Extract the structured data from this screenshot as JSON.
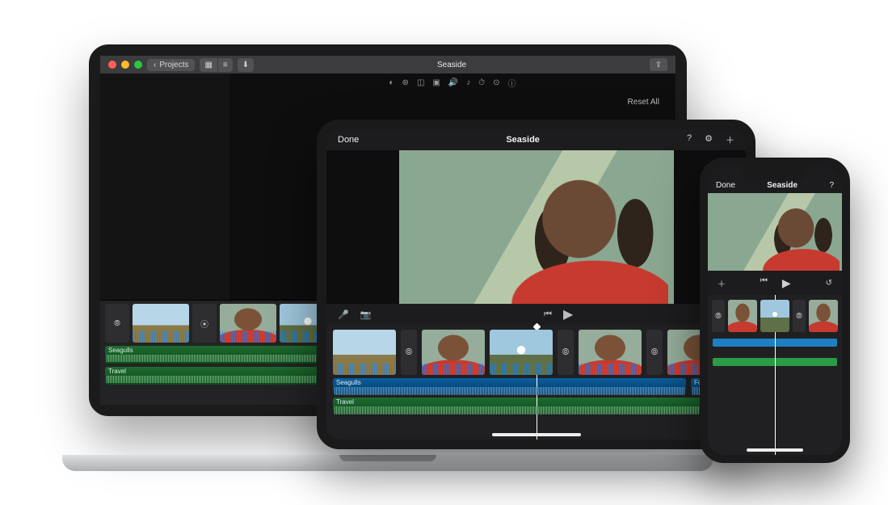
{
  "mac": {
    "back_label": "Projects",
    "title": "Seaside",
    "reset_label": "Reset All",
    "audio_tracks": [
      {
        "label": "Seagulls"
      },
      {
        "label": "Travel"
      }
    ]
  },
  "ipad": {
    "done_label": "Done",
    "title": "Seaside",
    "audio_tracks": [
      {
        "label": "Seagulls"
      },
      {
        "label": "Travel"
      }
    ],
    "audio_clip_label": "Fog Horn"
  },
  "iphone": {
    "done_label": "Done",
    "title": "Seaside"
  }
}
